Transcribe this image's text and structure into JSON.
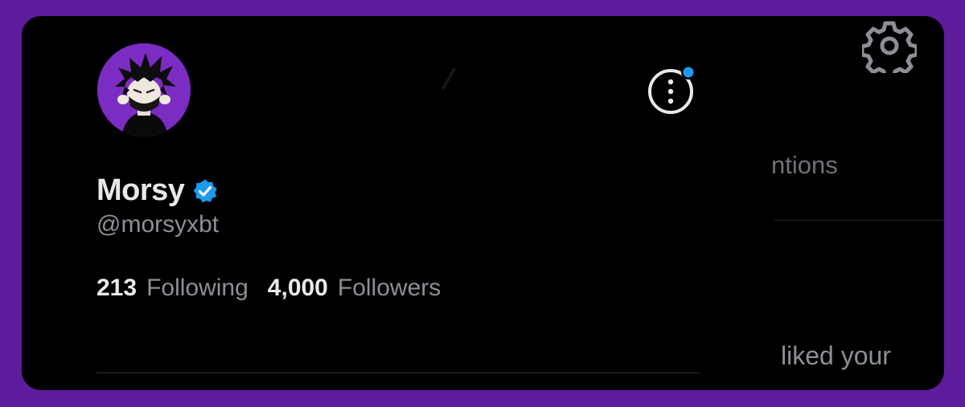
{
  "profile": {
    "display_name": "Morsy",
    "handle": "@morsyxbt",
    "verified": true,
    "following_count": "213",
    "following_label": "Following",
    "followers_count": "4,000",
    "followers_label": "Followers"
  },
  "background": {
    "tab_fragment": "ntions",
    "notification_fragment": "liked your"
  },
  "icons": {
    "more": "more-options-icon",
    "settings": "gear-icon",
    "verified": "verified-badge-icon"
  },
  "colors": {
    "frame": "#5d1c9c",
    "card": "#000000",
    "avatar_bg": "#7b2cc2",
    "verified": "#1d9bf0",
    "notification_dot": "#1d9bf0",
    "text_primary": "#e7e9ea",
    "text_secondary": "#8b9096"
  }
}
